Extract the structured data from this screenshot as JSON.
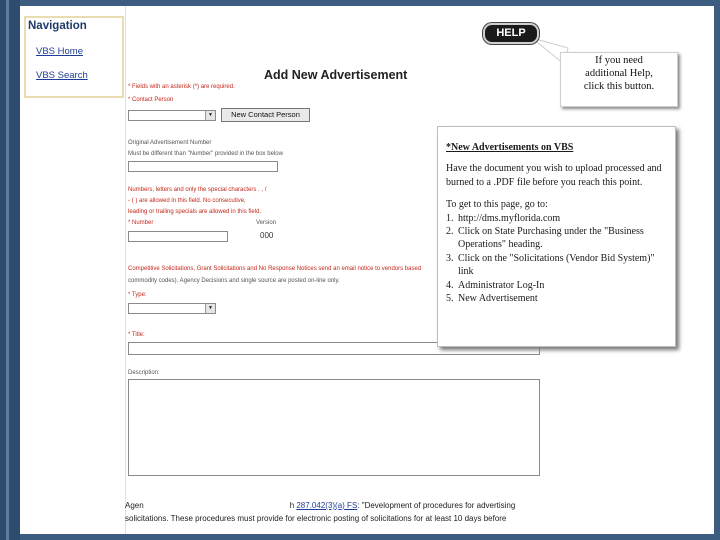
{
  "navigation": {
    "title": "Navigation",
    "items": [
      {
        "label": "VBS Home"
      },
      {
        "label": "VBS Search"
      }
    ]
  },
  "form": {
    "title": "Add New Advertisement",
    "required_note": "* Fields with an asterisk (*) are required.",
    "contact_label": "* Contact Person",
    "new_contact_button": "New Contact Person",
    "original_number_label": "Original Advertisement Number",
    "original_number_hint": "Must be different than \"Number\" provided in the box below",
    "number_rules": [
      "Numbers, letters and only the special characters . , /",
      "- ( ) are allowed in this field. No consecutive,",
      "leading or trailing specials are allowed in this field."
    ],
    "number_label": "* Number",
    "version_label": "Version",
    "version_value": "000",
    "competitive_note": "Competitive Solicitations, Grant Solicitations and No Response Notices send an email notice to vendors based",
    "commodity_note": "commodity codes). Agency Decisions and single source are posted on-line only.",
    "type_label": "* Type:",
    "title_label": "* Title:",
    "description_label": "Description:",
    "footer_text_a": "Agen",
    "footer_link": "287.042(3)(a) FS",
    "footer_text_b": ": \"Development of procedures for advertising",
    "footer_line2": "solicitations. These procedures must provide for electronic posting of solicitations for at least 10 days before"
  },
  "help": {
    "button_label": "HELP",
    "tooltip": [
      "If you need",
      "additional Help,",
      "click this button."
    ]
  },
  "info": {
    "heading": "*New Advertisements on VBS",
    "intro": "Have the document you wish to upload processed and burned to a .PDF file before you reach this point.",
    "steps_intro": "To get to this page, go to:",
    "steps": [
      {
        "num": "1.",
        "text": "http://dms.myflorida.com"
      },
      {
        "num": "2.",
        "text": "Click on State Purchasing under the \"Business Operations\" heading."
      },
      {
        "num": "3.",
        "text": "Click on the \"Solicitations (Vendor Bid System)\" link"
      },
      {
        "num": "4.",
        "text": "Administrator Log-In"
      },
      {
        "num": "5.",
        "text": "New Advertisement"
      }
    ]
  },
  "colors": {
    "frame": "#2d4c6e",
    "accent_red": "#c3281b",
    "link_blue": "#1e3d96"
  }
}
